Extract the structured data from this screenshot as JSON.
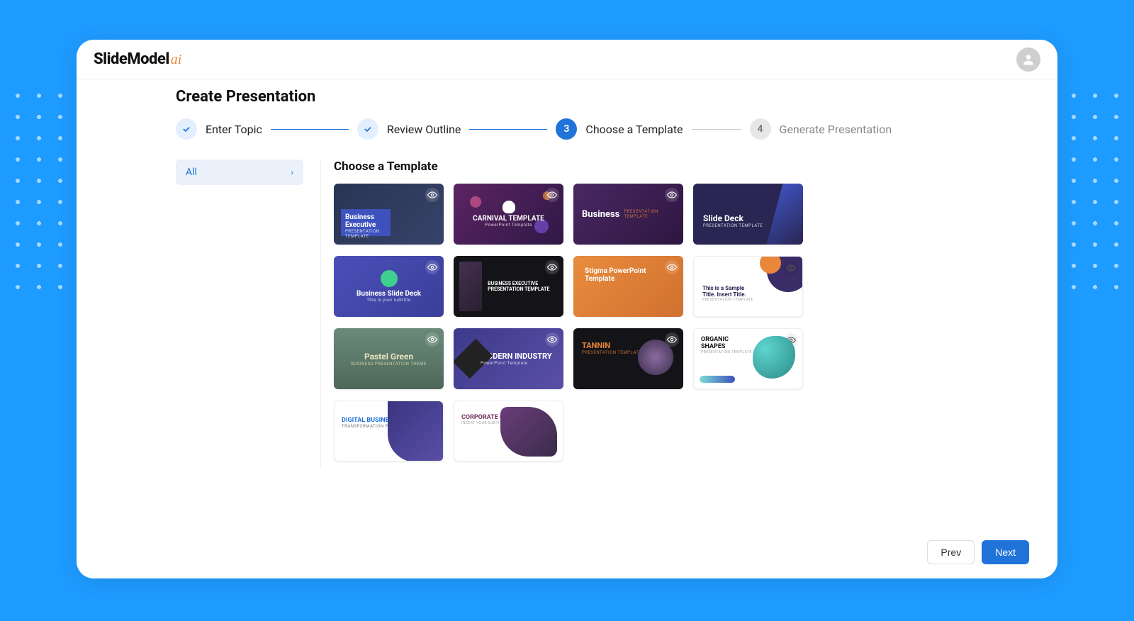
{
  "brand": {
    "main": "SlideModel",
    "sub": "ai"
  },
  "page_title": "Create Presentation",
  "steps": [
    {
      "label": "Enter Topic",
      "state": "done"
    },
    {
      "label": "Review Outline",
      "state": "done"
    },
    {
      "label": "Choose a Template",
      "state": "active",
      "num": "3"
    },
    {
      "label": "Generate Presentation",
      "state": "pending",
      "num": "4"
    }
  ],
  "sidebar": {
    "filter_all": "All"
  },
  "section_title": "Choose a Template",
  "templates": [
    {
      "id": "business-executive",
      "title": "Business Executive",
      "subtitle": "PRESENTATION TEMPLATE"
    },
    {
      "id": "carnival",
      "title": "CARNIVAL TEMPLATE",
      "subtitle": "PowerPoint Template"
    },
    {
      "id": "business",
      "title": "Business",
      "subtitle": "PRESENTATION TEMPLATE"
    },
    {
      "id": "slide-deck",
      "title": "Slide Deck",
      "subtitle": "PRESENTATION TEMPLATE"
    },
    {
      "id": "business-slide-deck",
      "title": "Business Slide Deck",
      "subtitle": "This is your subtitle"
    },
    {
      "id": "business-exec-presentation",
      "title": "BUSINESS EXECUTIVE PRESENTATION TEMPLATE",
      "subtitle": ""
    },
    {
      "id": "stigma",
      "title": "Stigma PowerPoint Template",
      "subtitle": ""
    },
    {
      "id": "sample-title",
      "title": "This is a Sample Title. Insert Title.",
      "subtitle": "PRESENTATION TEMPLATE"
    },
    {
      "id": "pastel-green",
      "title": "Pastel Green",
      "subtitle": "BUSINESS PRESENTATION THEME"
    },
    {
      "id": "modern-industry",
      "title": "MODERN INDUSTRY",
      "subtitle": "PowerPoint Template"
    },
    {
      "id": "tannin",
      "title": "TANNIN",
      "subtitle": "PRESENTATION TEMPLATE"
    },
    {
      "id": "organic-shapes",
      "title": "ORGANIC SHAPES",
      "subtitle": "PRESENTATION TEMPLATE"
    },
    {
      "id": "digital-business",
      "title": "DIGITAL BUSINESS",
      "subtitle": "TRANSFORMATION PROPOSAL"
    },
    {
      "id": "corporate-culture",
      "title": "CORPORATE CULTURE",
      "subtitle": "INSERT YOUR SUBTITLE HERE"
    }
  ],
  "footer": {
    "prev": "Prev",
    "next": "Next"
  }
}
